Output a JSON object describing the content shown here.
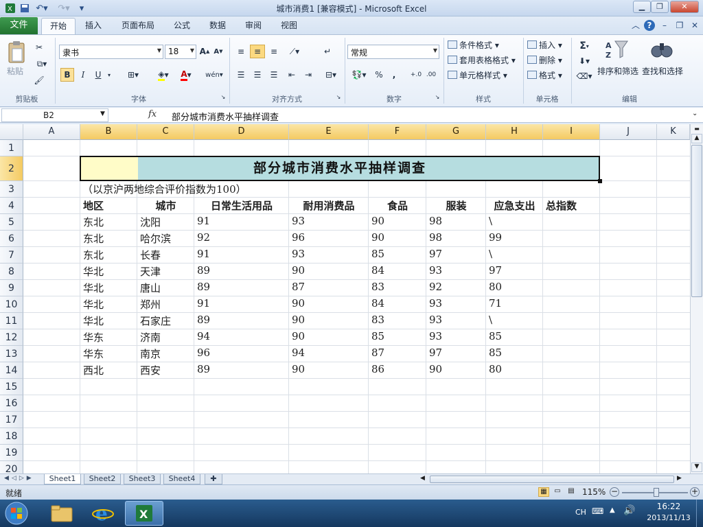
{
  "window": {
    "title": "城市消费1  [兼容模式] - Microsoft Excel"
  },
  "tabs": {
    "file": "文件",
    "home": "开始",
    "insert": "插入",
    "layout": "页面布局",
    "formulas": "公式",
    "data": "数据",
    "review": "审阅",
    "view": "视图"
  },
  "ribbon": {
    "clipboard": {
      "label": "剪贴板",
      "paste": "粘贴"
    },
    "font": {
      "label": "字体",
      "name": "隶书",
      "size": "18",
      "bold": "B",
      "italic": "I",
      "underline": "U"
    },
    "alignment": {
      "label": "对齐方式"
    },
    "number": {
      "label": "数字",
      "format": "常规",
      "percent": "%",
      "comma": ","
    },
    "styles": {
      "label": "样式",
      "conditional": "条件格式",
      "table": "套用表格格式",
      "cell": "单元格样式"
    },
    "cells": {
      "label": "单元格",
      "insert": "插入",
      "delete": "删除",
      "format": "格式"
    },
    "editing": {
      "label": "编辑",
      "sort": "排序和筛选",
      "find": "查找和选择",
      "sum": "Σ"
    }
  },
  "formula_bar": {
    "name_box": "B2",
    "fx": "fx",
    "value": "部分城市消费水平抽样调查"
  },
  "columns": [
    "A",
    "B",
    "C",
    "D",
    "E",
    "F",
    "G",
    "H",
    "I",
    "J",
    "K"
  ],
  "rows": [
    "1",
    "2",
    "3",
    "4",
    "5",
    "6",
    "7",
    "8",
    "9",
    "10",
    "11",
    "12",
    "13",
    "14",
    "15",
    "16",
    "17",
    "18",
    "19",
    "20"
  ],
  "sheet": {
    "title": "部分城市消费水平抽样调查",
    "note": "（以京沪两地综合评价指数为100）",
    "headers": [
      "地区",
      "城市",
      "日常生活用品",
      "耐用消费品",
      "食品",
      "服装",
      "应急支出",
      "总指数"
    ],
    "data": [
      [
        "东北",
        "沈阳",
        "91",
        "93",
        "90",
        "98",
        "\\"
      ],
      [
        "东北",
        "哈尔滨",
        "92",
        "96",
        "90",
        "98",
        "99"
      ],
      [
        "东北",
        "长春",
        "91",
        "93",
        "85",
        "97",
        "\\"
      ],
      [
        "华北",
        "天津",
        "89",
        "90",
        "84",
        "93",
        "97"
      ],
      [
        "华北",
        "唐山",
        "89",
        "87",
        "83",
        "92",
        "80"
      ],
      [
        "华北",
        "郑州",
        "91",
        "90",
        "84",
        "93",
        "71"
      ],
      [
        "华北",
        "石家庄",
        "89",
        "90",
        "83",
        "93",
        "\\"
      ],
      [
        "华东",
        "济南",
        "94",
        "90",
        "85",
        "93",
        "85"
      ],
      [
        "华东",
        "南京",
        "96",
        "94",
        "87",
        "97",
        "85"
      ],
      [
        "西北",
        "西安",
        "89",
        "90",
        "86",
        "90",
        "80"
      ]
    ]
  },
  "sheet_tabs": [
    "Sheet1",
    "Sheet2",
    "Sheet3",
    "Sheet4"
  ],
  "status": {
    "mode": "就绪",
    "zoom": "115%"
  },
  "taskbar": {
    "lang": "CH",
    "time": "16:22",
    "date": "2013/11/13"
  }
}
